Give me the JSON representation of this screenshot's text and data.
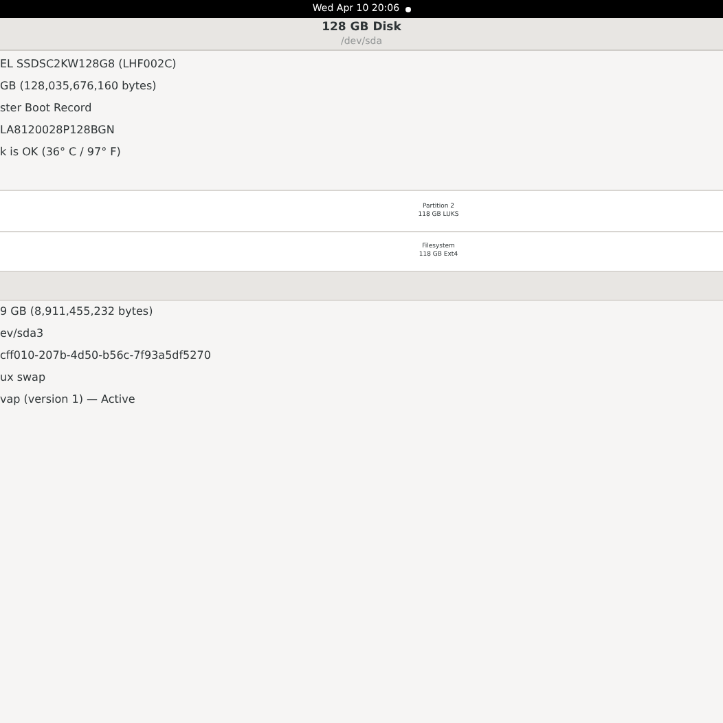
{
  "top_bar": {
    "clock": "Wed Apr 10  20:06"
  },
  "header": {
    "title": "128 GB Disk",
    "subtitle": "/dev/sda"
  },
  "disk_details": [
    "EL SSDSC2KW128G8 (LHF002C)",
    "GB (128,035,676,160 bytes)",
    "ster Boot Record",
    "LA8120028P128BGN",
    "k is OK (36° C / 97° F)"
  ],
  "volume_rows": [
    {
      "name": "Partition 2",
      "detail": "118 GB LUKS"
    },
    {
      "name": "Filesystem",
      "detail": "118 GB Ext4"
    }
  ],
  "volume_details": [
    "9 GB (8,911,455,232 bytes)",
    "ev/sda3",
    "cff010-207b-4d50-b56c-7f93a5df5270",
    "ux swap",
    "vap (version 1) — Active"
  ]
}
